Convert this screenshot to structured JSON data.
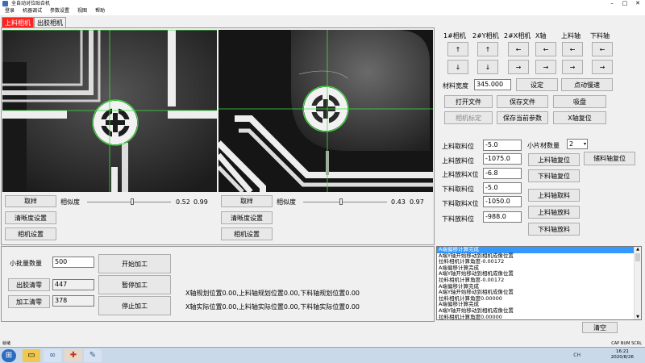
{
  "window": {
    "title": "全自动对位贴合机"
  },
  "menu": [
    "登录",
    "机器调试",
    "参数设置",
    "视图",
    "帮助"
  ],
  "tabs": [
    "上料相机",
    "出胶相机"
  ],
  "cam1": {
    "capture": "取样",
    "similarity_label": "相似度",
    "val1": "0.52",
    "val2": "0.99",
    "slider": 0.52,
    "clarity": "清晰度设置",
    "settings": "相机设置"
  },
  "cam2": {
    "capture": "取样",
    "similarity_label": "相似度",
    "val1": "0.43",
    "val2": "0.97",
    "slider": 0.43,
    "clarity": "清晰度设置",
    "settings": "相机设置"
  },
  "jog": {
    "headers": [
      "1#相机",
      "2#Y相机",
      "2#X相机",
      "X轴",
      "上料轴",
      "下料轴"
    ],
    "up": "↑",
    "down": "↓",
    "left": "←",
    "right": "→"
  },
  "material_width": {
    "label": "材料宽度",
    "value": "345.000",
    "set": "设定",
    "jog_move": "点动慢速"
  },
  "actions": {
    "open_file": "打开文件",
    "save_file": "保存文件",
    "vacuum": "吸盘",
    "camera_calib": "相机标定",
    "save_params": "保存当前参数",
    "x_reset": "X轴复位"
  },
  "positions": [
    {
      "label": "上料取料位",
      "value": "-5.0"
    },
    {
      "label": "上料放料位",
      "value": "-1075.0"
    },
    {
      "label": "上料放料X位",
      "value": "-6.8"
    },
    {
      "label": "下料取料位",
      "value": "-5.0"
    },
    {
      "label": "下料取料X位",
      "value": "-1050.0"
    },
    {
      "label": "下料放料位",
      "value": "-988.0"
    }
  ],
  "small_count": {
    "label": "小片材数量",
    "value": "2"
  },
  "axis_buttons": {
    "load_reset": "上料轴复位",
    "unload_reset": "下料轴复位",
    "stock_reset": "储料轴复位",
    "load_take": "上料轴取料",
    "load_put": "上料轴放料",
    "unload_put": "下料轴放料"
  },
  "batch": {
    "count_label": "小批量数量",
    "count_value": "500",
    "glue_reset": "出胶清零",
    "glue_value": "447",
    "process_reset": "加工清零",
    "process_value": "378",
    "start": "开始加工",
    "pause": "暂停加工",
    "stop": "停止加工"
  },
  "plan_positions": "X轴规划位置0.00,上料轴规划位置0.00,下料轴规划位置0.00",
  "actual_positions": "X轴实际位置0.00,上料轴实际位置0.00,下料轴实际位置0.00",
  "log": [
    "A端偏移计算完成",
    "A端Y轴开始移动到相机成像位置",
    "拉料相机计算角度-0.00172",
    "A端偏移计算完成",
    "A端Y轴开始移动到相机成像位置",
    "拉料相机计算角度-0.00172",
    "A端偏移计算完成",
    "A端Y轴开始移动到相机成像位置",
    "拉料相机计算角度0.00000",
    "A端偏移计算完成",
    "A端Y轴开始移动到相机成像位置",
    "拉料相机计算角度0.00000"
  ],
  "clear": "清空",
  "status": {
    "left": "就绪",
    "right": "CAP  NUM  SCRL"
  },
  "clock": {
    "time": "16:21",
    "date": "2020/8/26"
  },
  "tray": "CH"
}
